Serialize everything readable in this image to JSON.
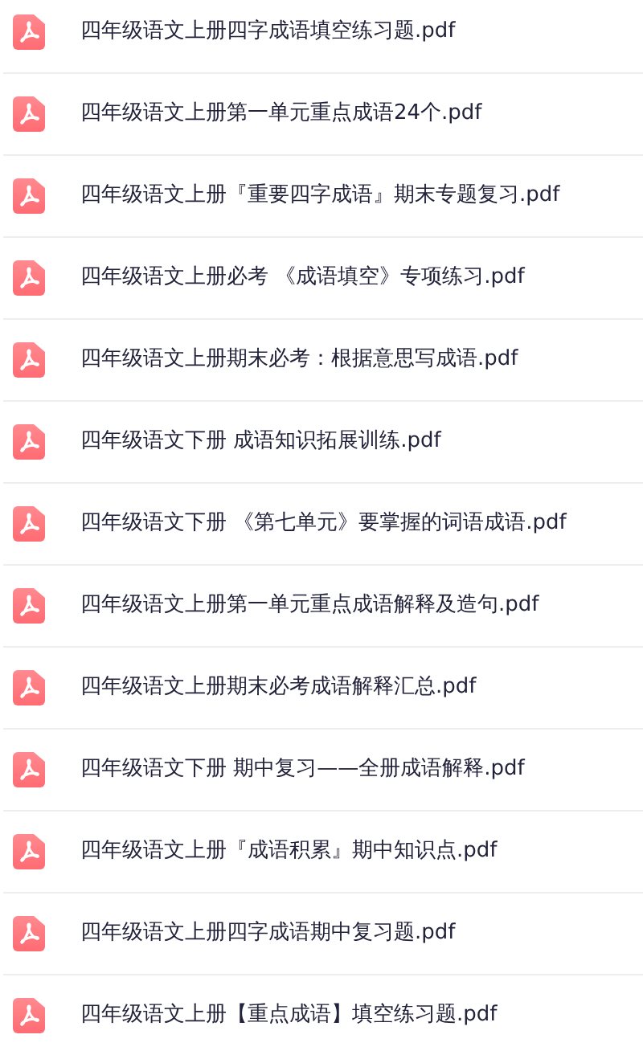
{
  "files": [
    {
      "name": "四年级语文上册四字成语填空练习题.pdf"
    },
    {
      "name": "四年级语文上册第一单元重点成语24个.pdf"
    },
    {
      "name": "四年级语文上册『重要四字成语』期末专题复习.pdf"
    },
    {
      "name": "四年级语文上册必考 《成语填空》专项练习.pdf"
    },
    {
      "name": "四年级语文上册期末必考：根据意思写成语.pdf"
    },
    {
      "name": "四年级语文下册 成语知识拓展训练.pdf"
    },
    {
      "name": "四年级语文下册 《第七单元》要掌握的词语成语.pdf"
    },
    {
      "name": "四年级语文上册第一单元重点成语解释及造句.pdf"
    },
    {
      "name": "四年级语文上册期末必考成语解释汇总.pdf"
    },
    {
      "name": "四年级语文下册 期中复习——全册成语解释.pdf"
    },
    {
      "name": "四年级语文上册『成语积累』期中知识点.pdf"
    },
    {
      "name": "四年级语文上册四字成语期中复习题.pdf"
    },
    {
      "name": "四年级语文上册【重点成语】填空练习题.pdf"
    }
  ]
}
